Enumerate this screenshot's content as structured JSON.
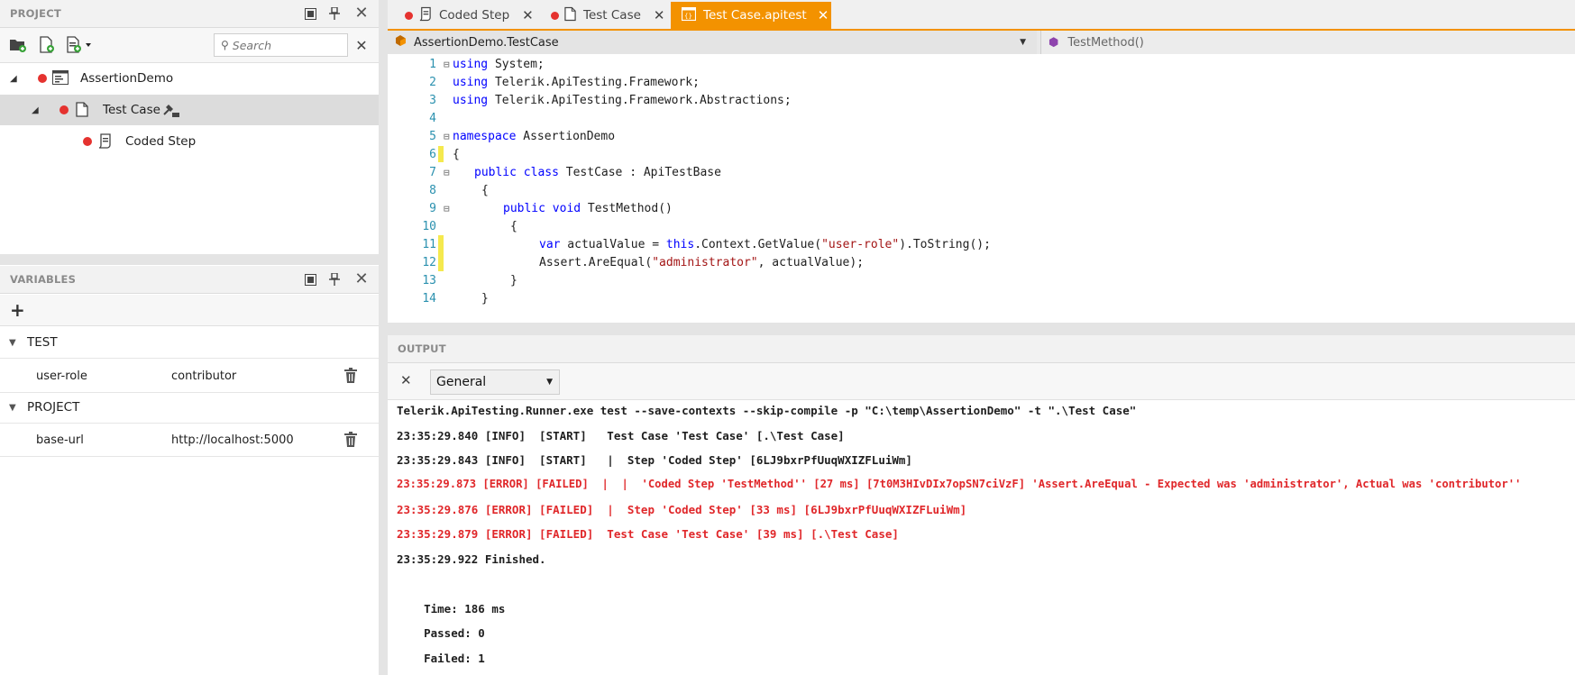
{
  "project": {
    "title": "PROJECT",
    "search_placeholder": "Search",
    "tree": [
      {
        "label": "AssertionDemo"
      },
      {
        "label": "Test Case"
      },
      {
        "label": "Coded Step"
      }
    ]
  },
  "variables": {
    "title": "VARIABLES",
    "groups": [
      {
        "name": "TEST",
        "rows": [
          {
            "key": "user-role",
            "value": "contributor"
          }
        ]
      },
      {
        "name": "PROJECT",
        "rows": [
          {
            "key": "base-url",
            "value": "http://localhost:5000"
          }
        ]
      }
    ]
  },
  "tabs": [
    {
      "label": "Coded Step"
    },
    {
      "label": "Test Case"
    },
    {
      "label": "Test Case.apitest"
    }
  ],
  "nav": {
    "class_selector": "AssertionDemo.TestCase",
    "member_selector": "TestMethod()"
  },
  "code": {
    "line_numbers": [
      "1",
      "2",
      "3",
      "4",
      "5",
      "6",
      "7",
      "8",
      "9",
      "10",
      "11",
      "12",
      "13",
      "14"
    ]
  },
  "output": {
    "title": "OUTPUT",
    "source": "General",
    "lines": [
      "Telerik.ApiTesting.Runner.exe test --save-contexts --skip-compile -p \"C:\\temp\\AssertionDemo\" -t \".\\Test Case\"",
      "23:35:29.840 [INFO]  [START]   Test Case 'Test Case' [.\\Test Case]",
      "23:35:29.843 [INFO]  [START]   |  Step 'Coded Step' [6LJ9bxrPfUuqWXIZFLuiWm]",
      "23:35:29.873 [ERROR] [FAILED]  |  |  'Coded Step 'TestMethod'' [27 ms] [7t0M3HIvDIx7opSN7ciVzF] 'Assert.AreEqual - Expected was 'administrator', Actual was 'contributor''",
      "23:35:29.876 [ERROR] [FAILED]  |  Step 'Coded Step' [33 ms] [6LJ9bxrPfUuqWXIZFLuiWm]",
      "23:35:29.879 [ERROR] [FAILED]  Test Case 'Test Case' [39 ms] [.\\Test Case]",
      "23:35:29.922 Finished.",
      "",
      "    Time: 186 ms",
      "    Passed: 0",
      "    Failed: 1"
    ]
  },
  "colors": {
    "accent": "#f39200",
    "error": "#e0272a",
    "keyword": "#0000ff",
    "string": "#a31515",
    "line_number": "#2b91af",
    "change_marker": "#f5e94e"
  }
}
